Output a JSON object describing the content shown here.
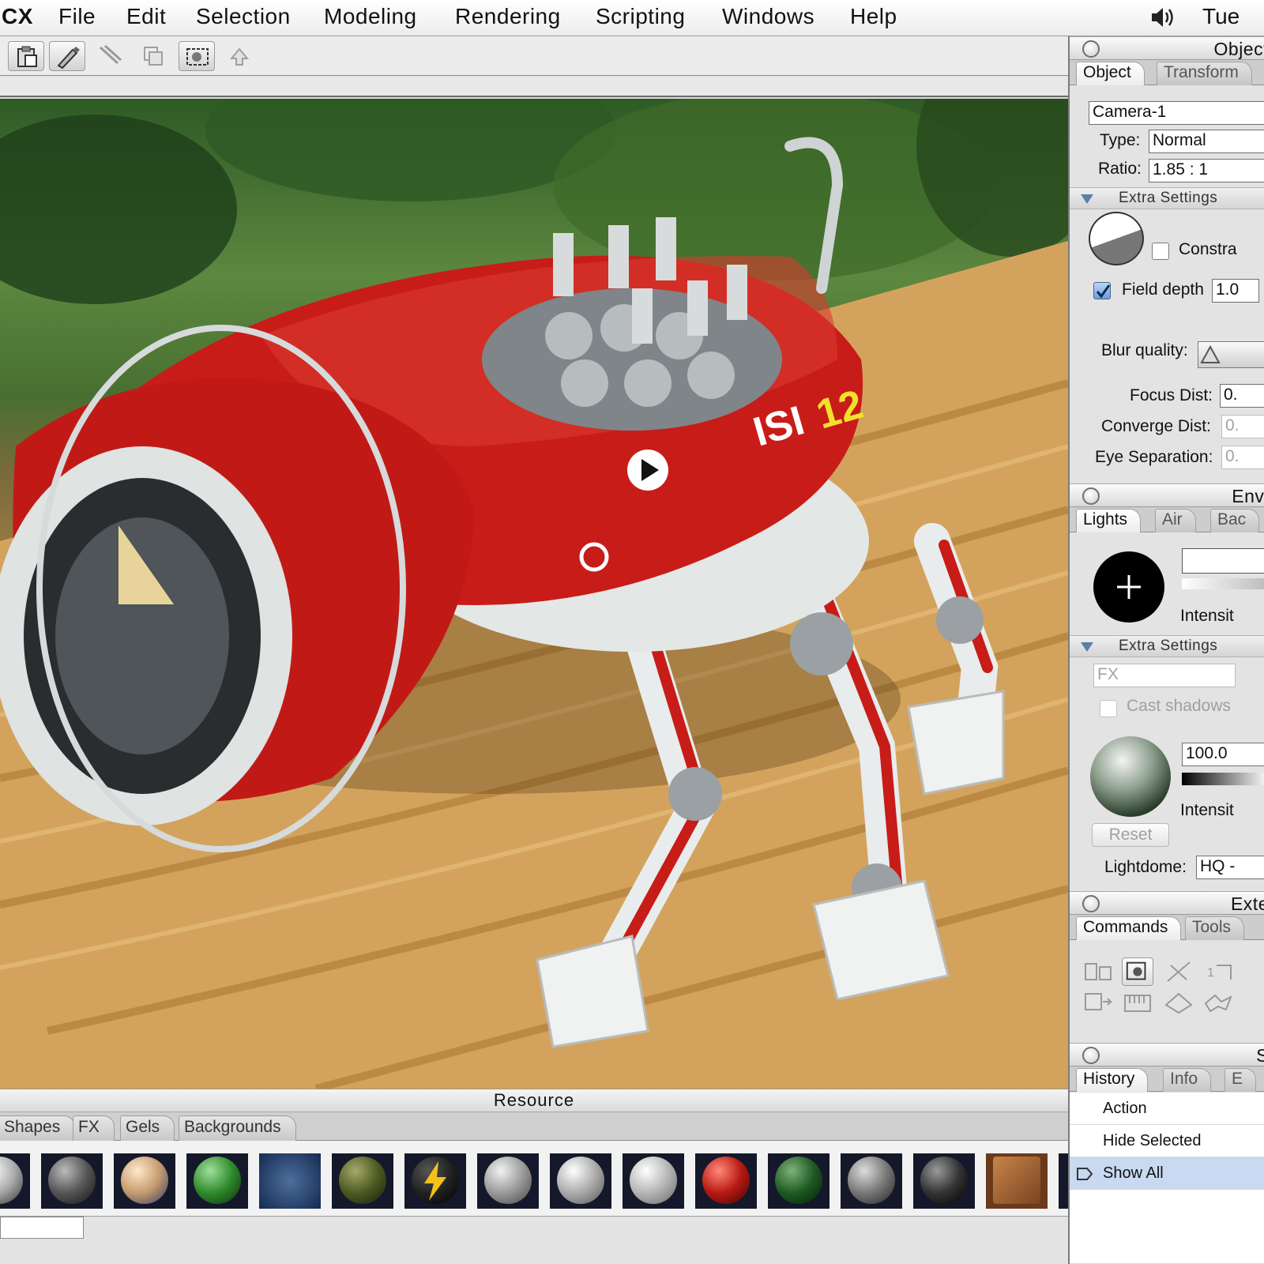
{
  "menubar": {
    "app_name": "CX",
    "items": [
      "File",
      "Edit",
      "Selection",
      "Modeling",
      "Rendering",
      "Scripting",
      "Windows",
      "Help"
    ],
    "clock": "Tue"
  },
  "resource": {
    "title": "Resource",
    "tabs": [
      "Shapes",
      "FX",
      "Gels",
      "Backgrounds"
    ]
  },
  "object_palette": {
    "title": "Object",
    "tabs": [
      "Object",
      "Transform"
    ],
    "name_value": "Camera-1",
    "type_label": "Type:",
    "type_value": "Normal",
    "ratio_label": "Ratio:",
    "ratio_value": "1.85 : 1",
    "extra_settings": "Extra Settings",
    "constrain_label": "Constra",
    "field_depth_label": "Field depth",
    "field_depth_value": "1.0",
    "blur_quality_label": "Blur quality:",
    "focus_label": "Focus Dist:",
    "focus_value": "0.",
    "converge_label": "Converge Dist:",
    "converge_value": "0.",
    "eye_label": "Eye Separation:",
    "eye_value": "0."
  },
  "environment_palette": {
    "title": "Envi",
    "tabs": [
      "Lights",
      "Air",
      "Bac"
    ],
    "intensity_label": "Intensit",
    "extra_settings": "Extra Settings",
    "fx_value": "FX",
    "cast_shadows_label": "Cast shadows",
    "lightdome_intensity_value": "100.0",
    "intensity_label_2": "Intensit",
    "reset_label": "Reset",
    "lightdome_label": "Lightdome:",
    "lightdome_value": "HQ -"
  },
  "extensions_palette": {
    "title": "Exte",
    "tabs": [
      "Commands",
      "Tools"
    ]
  },
  "history_palette": {
    "title": "S",
    "tabs": [
      "History",
      "Info",
      "E"
    ],
    "header": "Action",
    "rows": [
      "Hide Selected",
      "Show All"
    ]
  },
  "colors": {
    "accent": "#6c9ed8",
    "selection": "#c8d9f1",
    "robot_red": "#c81c18"
  }
}
